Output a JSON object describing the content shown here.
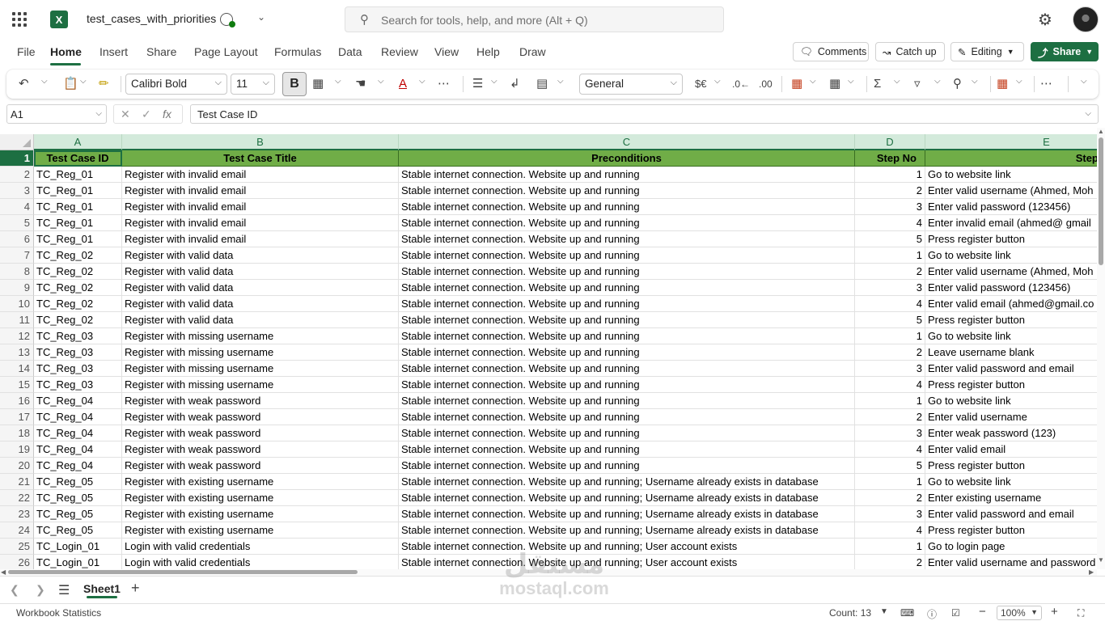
{
  "app": {
    "doc_title": "test_cases_with_priorities",
    "search_placeholder": "Search for tools, help, and more (Alt + Q)"
  },
  "menu": {
    "tabs": [
      "File",
      "Home",
      "Insert",
      "Share",
      "Page Layout",
      "Formulas",
      "Data",
      "Review",
      "View",
      "Help",
      "Draw"
    ],
    "active_tab": "Home",
    "comments_label": "Comments",
    "catchup_label": "Catch up",
    "editing_label": "Editing",
    "share_label": "Share"
  },
  "ribbon": {
    "font_name": "Calibri Bold",
    "font_size": "11",
    "bold_label": "B",
    "number_format": "General",
    "currency_label": "$€"
  },
  "formula_bar": {
    "name_box": "A1",
    "fx_label": "fx",
    "content": "Test Case ID"
  },
  "grid": {
    "columns": [
      "A",
      "B",
      "C",
      "D",
      "E"
    ],
    "header_row": {
      "row_num": "1",
      "cells": [
        "Test Case ID",
        "Test Case Title",
        "Preconditions",
        "Step No",
        "Step Description"
      ]
    },
    "rows": [
      {
        "n": "2",
        "id": "TC_Reg_01",
        "title": "Register with invalid email",
        "pre": "Stable internet connection. Website up and running",
        "step": "1",
        "desc": "Go to website link"
      },
      {
        "n": "3",
        "id": "TC_Reg_01",
        "title": "Register with invalid email",
        "pre": "Stable internet connection. Website up and running",
        "step": "2",
        "desc": "Enter valid username (Ahmed, Moh"
      },
      {
        "n": "4",
        "id": "TC_Reg_01",
        "title": "Register with invalid email",
        "pre": "Stable internet connection. Website up and running",
        "step": "3",
        "desc": "Enter valid password (123456)"
      },
      {
        "n": "5",
        "id": "TC_Reg_01",
        "title": "Register with invalid email",
        "pre": "Stable internet connection. Website up and running",
        "step": "4",
        "desc": "Enter invalid email (ahmed@ gmail"
      },
      {
        "n": "6",
        "id": "TC_Reg_01",
        "title": "Register with invalid email",
        "pre": "Stable internet connection. Website up and running",
        "step": "5",
        "desc": "Press register button"
      },
      {
        "n": "7",
        "id": "TC_Reg_02",
        "title": "Register with valid data",
        "pre": "Stable internet connection. Website up and running",
        "step": "1",
        "desc": "Go to website link"
      },
      {
        "n": "8",
        "id": "TC_Reg_02",
        "title": "Register with valid data",
        "pre": "Stable internet connection. Website up and running",
        "step": "2",
        "desc": "Enter valid username (Ahmed, Moh"
      },
      {
        "n": "9",
        "id": "TC_Reg_02",
        "title": "Register with valid data",
        "pre": "Stable internet connection. Website up and running",
        "step": "3",
        "desc": "Enter valid password (123456)"
      },
      {
        "n": "10",
        "id": "TC_Reg_02",
        "title": "Register with valid data",
        "pre": "Stable internet connection. Website up and running",
        "step": "4",
        "desc": "Enter valid email (ahmed@gmail.co"
      },
      {
        "n": "11",
        "id": "TC_Reg_02",
        "title": "Register with valid data",
        "pre": "Stable internet connection. Website up and running",
        "step": "5",
        "desc": "Press register button"
      },
      {
        "n": "12",
        "id": "TC_Reg_03",
        "title": "Register with missing username",
        "pre": "Stable internet connection. Website up and running",
        "step": "1",
        "desc": "Go to website link"
      },
      {
        "n": "13",
        "id": "TC_Reg_03",
        "title": "Register with missing username",
        "pre": "Stable internet connection. Website up and running",
        "step": "2",
        "desc": "Leave username blank"
      },
      {
        "n": "14",
        "id": "TC_Reg_03",
        "title": "Register with missing username",
        "pre": "Stable internet connection. Website up and running",
        "step": "3",
        "desc": "Enter valid password and email"
      },
      {
        "n": "15",
        "id": "TC_Reg_03",
        "title": "Register with missing username",
        "pre": "Stable internet connection. Website up and running",
        "step": "4",
        "desc": "Press register button"
      },
      {
        "n": "16",
        "id": "TC_Reg_04",
        "title": "Register with weak password",
        "pre": "Stable internet connection. Website up and running",
        "step": "1",
        "desc": "Go to website link"
      },
      {
        "n": "17",
        "id": "TC_Reg_04",
        "title": "Register with weak password",
        "pre": "Stable internet connection. Website up and running",
        "step": "2",
        "desc": "Enter valid username"
      },
      {
        "n": "18",
        "id": "TC_Reg_04",
        "title": "Register with weak password",
        "pre": "Stable internet connection. Website up and running",
        "step": "3",
        "desc": "Enter weak password (123)"
      },
      {
        "n": "19",
        "id": "TC_Reg_04",
        "title": "Register with weak password",
        "pre": "Stable internet connection. Website up and running",
        "step": "4",
        "desc": "Enter valid email"
      },
      {
        "n": "20",
        "id": "TC_Reg_04",
        "title": "Register with weak password",
        "pre": "Stable internet connection. Website up and running",
        "step": "5",
        "desc": "Press register button"
      },
      {
        "n": "21",
        "id": "TC_Reg_05",
        "title": "Register with existing username",
        "pre": "Stable internet connection. Website up and running; Username already exists in database",
        "step": "1",
        "desc": "Go to website link"
      },
      {
        "n": "22",
        "id": "TC_Reg_05",
        "title": "Register with existing username",
        "pre": "Stable internet connection. Website up and running; Username already exists in database",
        "step": "2",
        "desc": "Enter existing username"
      },
      {
        "n": "23",
        "id": "TC_Reg_05",
        "title": "Register with existing username",
        "pre": "Stable internet connection. Website up and running; Username already exists in database",
        "step": "3",
        "desc": "Enter valid password and email"
      },
      {
        "n": "24",
        "id": "TC_Reg_05",
        "title": "Register with existing username",
        "pre": "Stable internet connection. Website up and running; Username already exists in database",
        "step": "4",
        "desc": "Press register button"
      },
      {
        "n": "25",
        "id": "TC_Login_01",
        "title": "Login with valid credentials",
        "pre": "Stable internet connection. Website up and running; User account exists",
        "step": "1",
        "desc": "Go to login page"
      },
      {
        "n": "26",
        "id": "TC_Login_01",
        "title": "Login with valid credentials",
        "pre": "Stable internet connection. Website up and running; User account exists",
        "step": "2",
        "desc": "Enter valid username and password"
      }
    ]
  },
  "sheets": {
    "tabs": [
      "Sheet1"
    ],
    "active": "Sheet1"
  },
  "status": {
    "left": "Workbook Statistics",
    "count": "Count: 13",
    "zoom": "100%"
  },
  "watermark": {
    "arabic": "مستقل",
    "latin": "mostaql.com"
  },
  "colors": {
    "accent": "#1d6f42",
    "header_fill": "#70ad47",
    "column_header_fill": "#d3eadb"
  }
}
